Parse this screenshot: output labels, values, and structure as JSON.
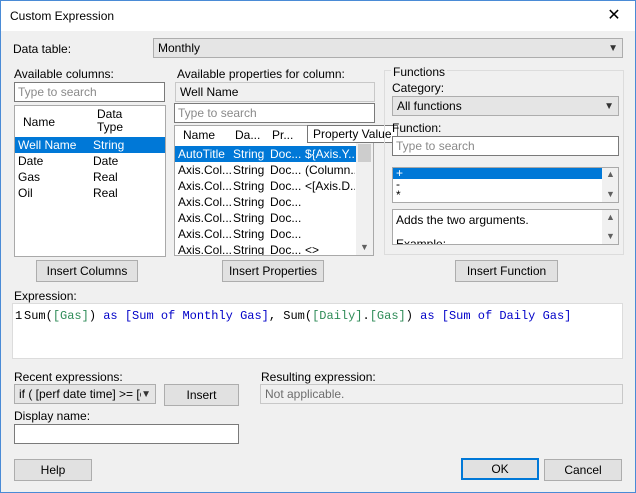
{
  "window": {
    "title": "Custom Expression",
    "close_glyph": "✕"
  },
  "data_table": {
    "label": "Data table:",
    "value": "Monthly"
  },
  "available_columns": {
    "label": "Available columns:",
    "search_placeholder": "Type to search",
    "headers": [
      "Name",
      "Data Type"
    ],
    "rows": [
      {
        "name": "Well Name",
        "type": "String",
        "selected": true
      },
      {
        "name": "Date",
        "type": "Date",
        "selected": false
      },
      {
        "name": "Gas",
        "type": "Real",
        "selected": false
      },
      {
        "name": "Oil",
        "type": "Real",
        "selected": false
      }
    ],
    "insert_button": "Insert Columns"
  },
  "available_properties": {
    "label": "Available properties for column:",
    "column_value": "Well Name",
    "search_placeholder": "Type to search",
    "headers": [
      "Name",
      "Da...",
      "Pr...",
      "Property Value"
    ],
    "rows": [
      {
        "name": "AutoTitle",
        "type": "String",
        "prop": "Doc...",
        "value": "${Axis.Y...",
        "selected": true
      },
      {
        "name": "Axis.Col...",
        "type": "String",
        "prop": "Doc...",
        "value": "(Column...",
        "selected": false
      },
      {
        "name": "Axis.Col...",
        "type": "String",
        "prop": "Doc...",
        "value": "<[Axis.D...",
        "selected": false
      },
      {
        "name": "Axis.Col...",
        "type": "String",
        "prop": "Doc...",
        "value": "",
        "selected": false
      },
      {
        "name": "Axis.Col...",
        "type": "String",
        "prop": "Doc...",
        "value": "",
        "selected": false
      },
      {
        "name": "Axis.Col...",
        "type": "String",
        "prop": "Doc...",
        "value": "",
        "selected": false
      },
      {
        "name": "Axis.Col...",
        "type": "String",
        "prop": "Doc...",
        "value": "<>",
        "selected": false
      },
      {
        "name": "Axis.Col...",
        "type": "String",
        "prop": "Doc...",
        "value": "",
        "selected": false
      }
    ],
    "tooltip": "Property Value",
    "insert_button": "Insert Properties"
  },
  "functions": {
    "group_label": "Functions",
    "category_label": "Category:",
    "category_value": "All functions",
    "function_label": "Function:",
    "search_placeholder": "Type to search",
    "items": [
      {
        "label": "+",
        "selected": true
      },
      {
        "label": "-",
        "selected": false
      },
      {
        "label": "*",
        "selected": false
      }
    ],
    "description": "Adds the two arguments.",
    "description_more": "Example:",
    "insert_button": "Insert Function"
  },
  "expression": {
    "label": "Expression:",
    "line_number": "1",
    "tokens": [
      {
        "t": "Sum(",
        "c": "tok-fn"
      },
      {
        "t": "[Gas]",
        "c": "tok-col"
      },
      {
        "t": ") ",
        "c": "tok-p"
      },
      {
        "t": "as",
        "c": "tok-kw"
      },
      {
        "t": " ",
        "c": "tok-p"
      },
      {
        "t": "[Sum of Monthly Gas]",
        "c": "tok-alias"
      },
      {
        "t": ", ",
        "c": "tok-p"
      },
      {
        "t": "Sum(",
        "c": "tok-fn"
      },
      {
        "t": "[Daily]",
        "c": "tok-col"
      },
      {
        "t": ".",
        "c": "tok-p"
      },
      {
        "t": "[Gas]",
        "c": "tok-col"
      },
      {
        "t": ") ",
        "c": "tok-p"
      },
      {
        "t": "as",
        "c": "tok-kw"
      },
      {
        "t": " ",
        "c": "tok-p"
      },
      {
        "t": "[Sum of Daily Gas]",
        "c": "tok-alias"
      }
    ]
  },
  "recent": {
    "label": "Recent expressions:",
    "value": "if ( [perf date time] >= [c.y",
    "insert_button": "Insert"
  },
  "resulting": {
    "label": "Resulting expression:",
    "value": "Not applicable."
  },
  "display_name": {
    "label": "Display name:",
    "value": ""
  },
  "buttons": {
    "help": "Help",
    "ok": "OK",
    "cancel": "Cancel"
  }
}
